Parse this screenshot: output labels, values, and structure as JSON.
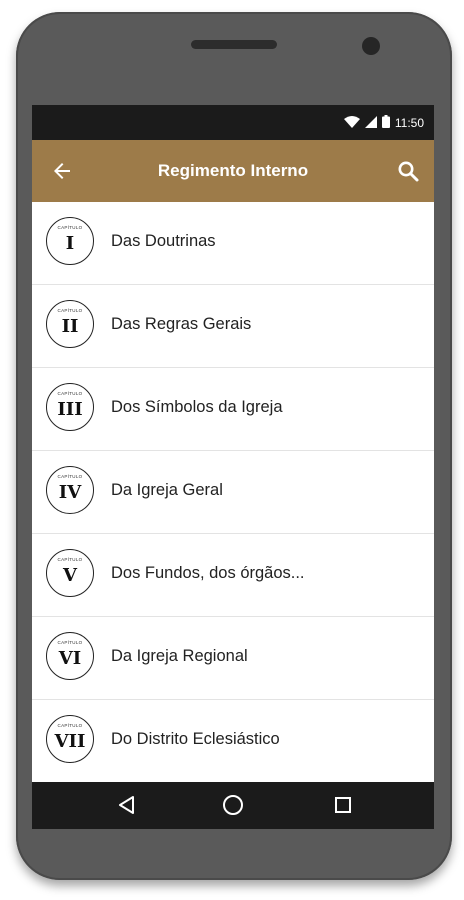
{
  "status_bar": {
    "time": "11:50"
  },
  "app_bar": {
    "title": "Regimento Interno"
  },
  "chapter_word": "CAPÍTULO",
  "chapters": [
    {
      "numeral": "I",
      "title": "Das Doutrinas"
    },
    {
      "numeral": "II",
      "title": "Das Regras Gerais"
    },
    {
      "numeral": "III",
      "title": "Dos Símbolos da Igreja"
    },
    {
      "numeral": "IV",
      "title": "Da Igreja Geral"
    },
    {
      "numeral": "V",
      "title": "Dos Fundos, dos órgãos..."
    },
    {
      "numeral": "VI",
      "title": "Da Igreja Regional"
    },
    {
      "numeral": "VII",
      "title": "Do Distrito Eclesiástico"
    }
  ],
  "colors": {
    "app_bar": "#9d7b49",
    "status_bar": "#1b1b1b",
    "phone_body": "#5a5a5a"
  },
  "icons": [
    "arrow-back-icon",
    "search-icon",
    "wifi-icon",
    "signal-icon",
    "battery-icon",
    "nav-back-icon",
    "nav-home-icon",
    "nav-recents-icon"
  ]
}
